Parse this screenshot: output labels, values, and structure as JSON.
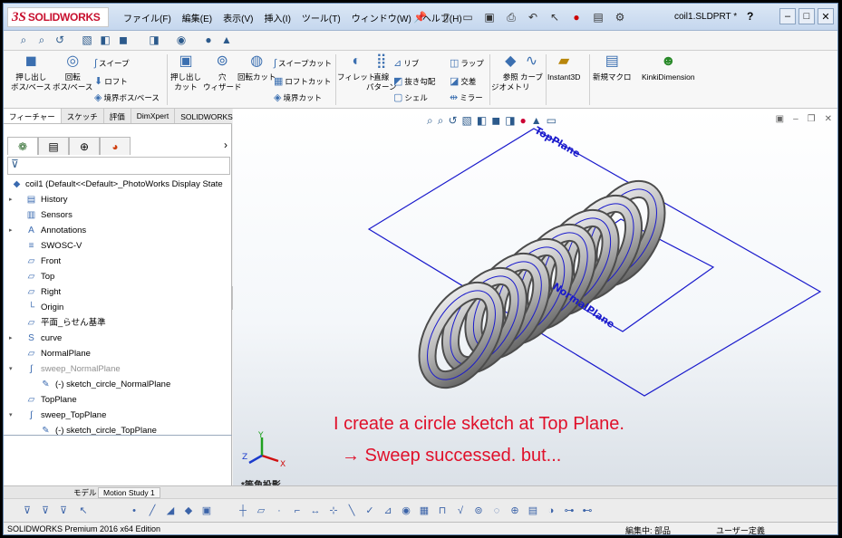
{
  "app": {
    "logo_mark": "3S",
    "logo_text": "SOLIDWORKS",
    "doc_title": "coil1.SLDPRT *",
    "help": "?"
  },
  "menu": [
    "ファイル(F)",
    "編集(E)",
    "表示(V)",
    "挿入(I)",
    "ツール(T)",
    "ウィンドウ(W)",
    "ヘルプ(H)"
  ],
  "features": {
    "extrude": "押し出し\nボス/ベース",
    "revolve": "回転\nボス/ベース",
    "sweep": "スイープ",
    "loft": "ロフト",
    "boundary": "境界ボス/ベース",
    "cut_extrude": "押し出し\nカット",
    "hole_wizard": "穴\nウィザード",
    "revolve_cut": "回転カット",
    "swept_cut": "スイープカット",
    "lofted_cut": "ロフトカット",
    "boundary_cut": "境界カット",
    "fillet": "フィレット",
    "linear_pattern": "直線\nパターン",
    "rib": "リブ",
    "draft": "抜き勾配",
    "shell": "シェル",
    "wrap": "ラップ",
    "intersect": "交差",
    "mirror": "ミラー",
    "ref_geom": "参照\nジオメトリ",
    "curves": "カーブ",
    "instant3d": "Instant3D",
    "new_macro": "新規マクロ",
    "kinki": "KinkiDimension"
  },
  "tabs": [
    "フィーチャー",
    "スケッチ",
    "評価",
    "DimXpert",
    "SOLIDWORKS アドイン"
  ],
  "tree": [
    {
      "label": "coil1  (Default<<Default>_PhotoWorks Display State",
      "icon": "part-icon",
      "indent": 0,
      "arrow": ""
    },
    {
      "label": "History",
      "icon": "history-icon",
      "indent": 1,
      "arrow": "▸"
    },
    {
      "label": "Sensors",
      "icon": "sensors-icon",
      "indent": 1,
      "arrow": ""
    },
    {
      "label": "Annotations",
      "icon": "annotations-icon",
      "indent": 1,
      "arrow": "▸"
    },
    {
      "label": "SWOSC-V",
      "icon": "material-icon",
      "indent": 1,
      "arrow": ""
    },
    {
      "label": "Front",
      "icon": "plane-icon",
      "indent": 1,
      "arrow": ""
    },
    {
      "label": "Top",
      "icon": "plane-icon",
      "indent": 1,
      "arrow": ""
    },
    {
      "label": "Right",
      "icon": "plane-icon",
      "indent": 1,
      "arrow": ""
    },
    {
      "label": "Origin",
      "icon": "origin-icon",
      "indent": 1,
      "arrow": ""
    },
    {
      "label": "平面_らせん基準",
      "icon": "plane-icon",
      "indent": 1,
      "arrow": ""
    },
    {
      "label": "curve",
      "icon": "helix-icon",
      "indent": 1,
      "arrow": "▸"
    },
    {
      "label": "NormalPlane",
      "icon": "plane-icon",
      "indent": 1,
      "arrow": ""
    },
    {
      "label": "sweep_NormalPlane",
      "icon": "sweep-icon",
      "indent": 1,
      "arrow": "▾",
      "grey": true
    },
    {
      "label": "(-) sketch_circle_NormalPlane",
      "icon": "sketch-icon",
      "indent": 2,
      "arrow": ""
    },
    {
      "label": "TopPlane",
      "icon": "plane-icon",
      "indent": 1,
      "arrow": ""
    },
    {
      "label": "sweep_TopPlane",
      "icon": "sweep-icon",
      "indent": 1,
      "arrow": "▾"
    },
    {
      "label": "(-) sketch_circle_TopPlane",
      "icon": "sketch-icon",
      "indent": 2,
      "arrow": ""
    }
  ],
  "viewport": {
    "plane_label_top": "TopPlane",
    "plane_label_normal": "NormalPlane",
    "caption_1": "I create a circle sketch at Top Plane.",
    "caption_2": "→   Sweep successed.  but...",
    "view_name": "*等角投影",
    "axis_x": "X",
    "axis_y": "Y",
    "axis_z": "Z"
  },
  "bottom_tabs": {
    "model": "モデル",
    "motion": "Motion Study 1"
  },
  "status": {
    "left": "SOLIDWORKS Premium 2016 x64 Edition",
    "mode": "編集中: 部品",
    "units": "ユーザー定義"
  },
  "colors": {
    "accent": "#c8102e",
    "plane": "#1a1acc",
    "caption": "#e0102a"
  }
}
